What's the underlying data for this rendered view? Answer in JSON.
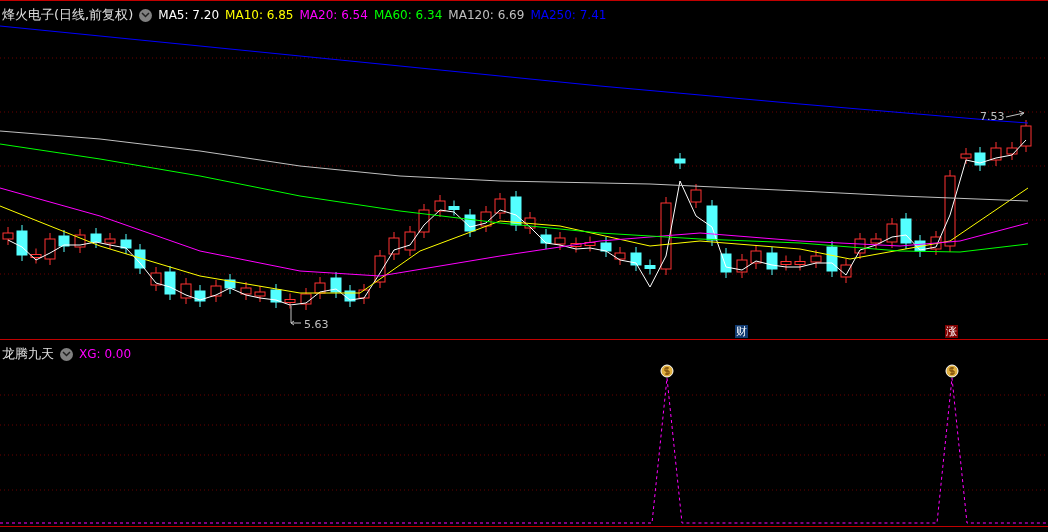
{
  "main_panel": {
    "title": "烽火电子(日线,前复权)",
    "indicators": [
      {
        "label": "MA5: 7.20",
        "color": "#ffffff"
      },
      {
        "label": "MA10: 6.85",
        "color": "#ffff00"
      },
      {
        "label": "MA20: 6.54",
        "color": "#ff00ff"
      },
      {
        "label": "MA60: 6.34",
        "color": "#00ff00"
      },
      {
        "label": "MA120: 6.69",
        "color": "#c0c0c0"
      },
      {
        "label": "MA250: 7.41",
        "color": "#0000ff"
      }
    ],
    "high_label": "7.53",
    "low_label": "5.63",
    "markers": [
      {
        "text": "财",
        "kind": "finance"
      },
      {
        "text": "涨",
        "kind": "rise"
      }
    ]
  },
  "sub_panel": {
    "title": "龙腾九天",
    "indicators": [
      {
        "label": "XG: 0.00",
        "color": "#ff00ff"
      }
    ]
  }
}
